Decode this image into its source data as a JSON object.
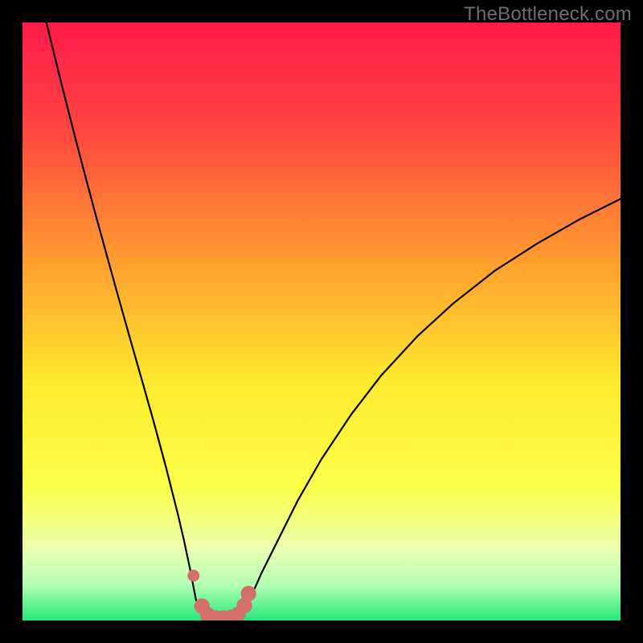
{
  "watermark": "TheBottleneck.com",
  "chart_data": {
    "type": "line",
    "title": "",
    "xlabel": "",
    "ylabel": "",
    "xlim": [
      0,
      100
    ],
    "ylim": [
      0,
      100
    ],
    "grid": false,
    "legend": false,
    "background_gradient": [
      {
        "pos": 0.0,
        "color": "#ff1a4b"
      },
      {
        "pos": 0.18,
        "color": "#ff4640"
      },
      {
        "pos": 0.4,
        "color": "#ff9e2f"
      },
      {
        "pos": 0.6,
        "color": "#ffe92e"
      },
      {
        "pos": 0.78,
        "color": "#faff4a"
      },
      {
        "pos": 0.88,
        "color": "#ecffb0"
      },
      {
        "pos": 0.94,
        "color": "#b3ffb3"
      },
      {
        "pos": 1.0,
        "color": "#26e87a"
      }
    ],
    "series": [
      {
        "name": "left-curve",
        "x": [
          4.0,
          6.0,
          8.0,
          10.0,
          12.0,
          14.0,
          16.0,
          18.0,
          20.0,
          22.0,
          24.0,
          26.0,
          27.0,
          28.0,
          29.0,
          30.0,
          31.0
        ],
        "y": [
          100.0,
          91.8,
          83.9,
          76.2,
          68.7,
          61.4,
          54.2,
          47.1,
          40.1,
          33.0,
          25.6,
          17.7,
          13.4,
          8.7,
          3.5,
          0.8,
          0.0
        ]
      },
      {
        "name": "right-curve",
        "x": [
          36.0,
          37.0,
          38.0,
          40.0,
          43.0,
          46.0,
          50.0,
          55.0,
          60.0,
          66.0,
          72.0,
          79.0,
          86.0,
          93.0,
          100.0
        ],
        "y": [
          0.0,
          1.5,
          3.5,
          8.0,
          14.0,
          20.0,
          27.0,
          34.5,
          41.0,
          47.5,
          53.0,
          58.5,
          63.0,
          67.0,
          70.5
        ]
      },
      {
        "name": "bottom-band",
        "x": [
          31.0,
          36.0
        ],
        "y": [
          0.0,
          0.0
        ]
      }
    ],
    "markers": {
      "color": "#d2706a",
      "points": [
        {
          "x": 28.6,
          "y": 7.5,
          "r": 1.0
        },
        {
          "x": 30.0,
          "y": 2.4,
          "r": 1.3
        },
        {
          "x": 31.0,
          "y": 0.9,
          "r": 1.3
        },
        {
          "x": 32.2,
          "y": 0.4,
          "r": 1.3
        },
        {
          "x": 33.5,
          "y": 0.4,
          "r": 1.3
        },
        {
          "x": 34.8,
          "y": 0.5,
          "r": 1.3
        },
        {
          "x": 36.0,
          "y": 1.0,
          "r": 1.3
        },
        {
          "x": 37.1,
          "y": 2.5,
          "r": 1.3
        },
        {
          "x": 37.8,
          "y": 4.5,
          "r": 1.3
        }
      ]
    }
  }
}
